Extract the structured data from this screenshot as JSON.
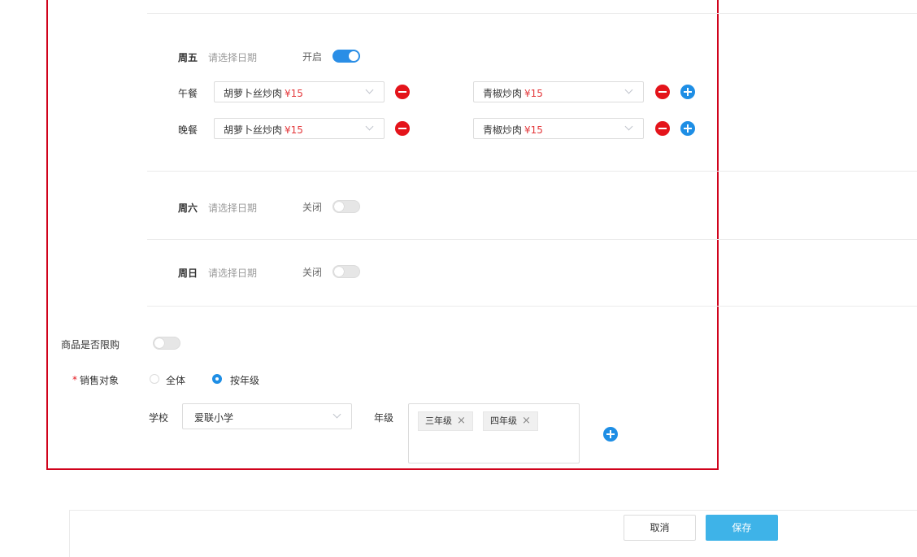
{
  "days": {
    "friday": {
      "name": "周五",
      "date_placeholder": "请选择日期",
      "status": "开启"
    },
    "saturday": {
      "name": "周六",
      "date_placeholder": "请选择日期",
      "status": "关闭"
    },
    "sunday": {
      "name": "周日",
      "date_placeholder": "请选择日期",
      "status": "关闭"
    }
  },
  "meals": {
    "lunch": {
      "label": "午餐",
      "dish1": {
        "name": "胡萝卜丝炒肉",
        "price": "¥15"
      },
      "dish2": {
        "name": "青椒炒肉",
        "price": "¥15"
      }
    },
    "dinner": {
      "label": "晚餐",
      "dish1": {
        "name": "胡萝卜丝炒肉",
        "price": "¥15"
      },
      "dish2": {
        "name": "青椒炒肉",
        "price": "¥15"
      }
    }
  },
  "purchase_limit": {
    "label": "商品是否限购",
    "enabled": false
  },
  "sales_target": {
    "required_mark": "*",
    "label": "销售对象",
    "option_all": "全体",
    "option_grade": "按年级",
    "selected": "按年级"
  },
  "school": {
    "label": "学校",
    "value": "爱联小学"
  },
  "grade": {
    "label": "年级",
    "tags": [
      "三年级",
      "四年级"
    ],
    "remove_glyph": "×"
  },
  "footer": {
    "cancel_label": "取消",
    "save_label": "保存"
  },
  "colors": {
    "accent": "#1e8ee5",
    "danger": "#e4141b",
    "price": "#e4393c",
    "highlight_border": "#d0021b"
  }
}
